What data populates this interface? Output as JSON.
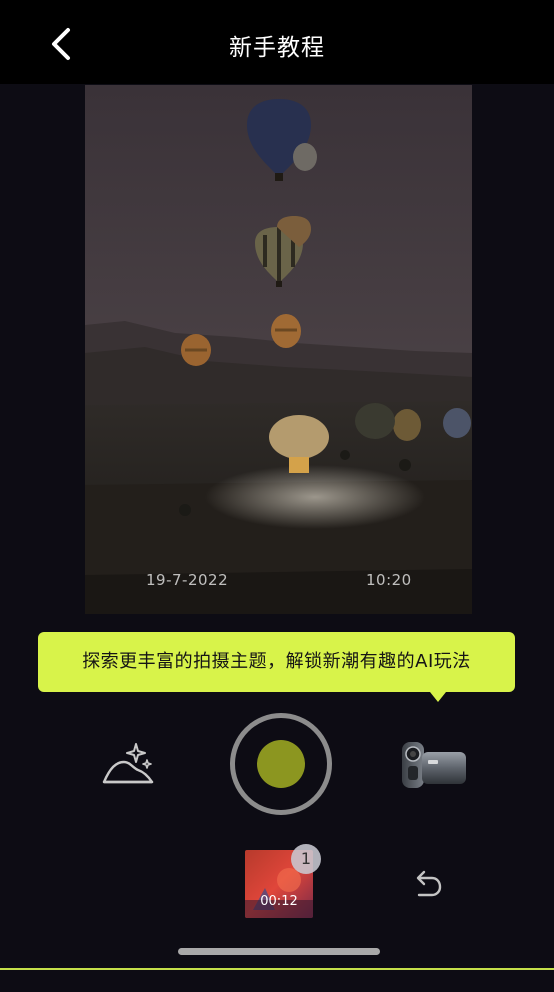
{
  "header": {
    "title": "新手教程",
    "back_icon": "chevron-left-icon"
  },
  "preview": {
    "date_stamp": "19-7-2022",
    "time_stamp": "10:20"
  },
  "tooltip": {
    "text": "探索更丰富的拍摄主题，解锁新潮有趣的AI玩法",
    "background": "#d8f34a"
  },
  "controls": {
    "scene_icon": "landscape-sparkle-icon",
    "shutter_color": "#8c9620",
    "camera_icon": "vintage-camcorder-icon"
  },
  "gallery": {
    "duration": "00:12",
    "count": "1",
    "undo_icon": "undo-icon"
  }
}
